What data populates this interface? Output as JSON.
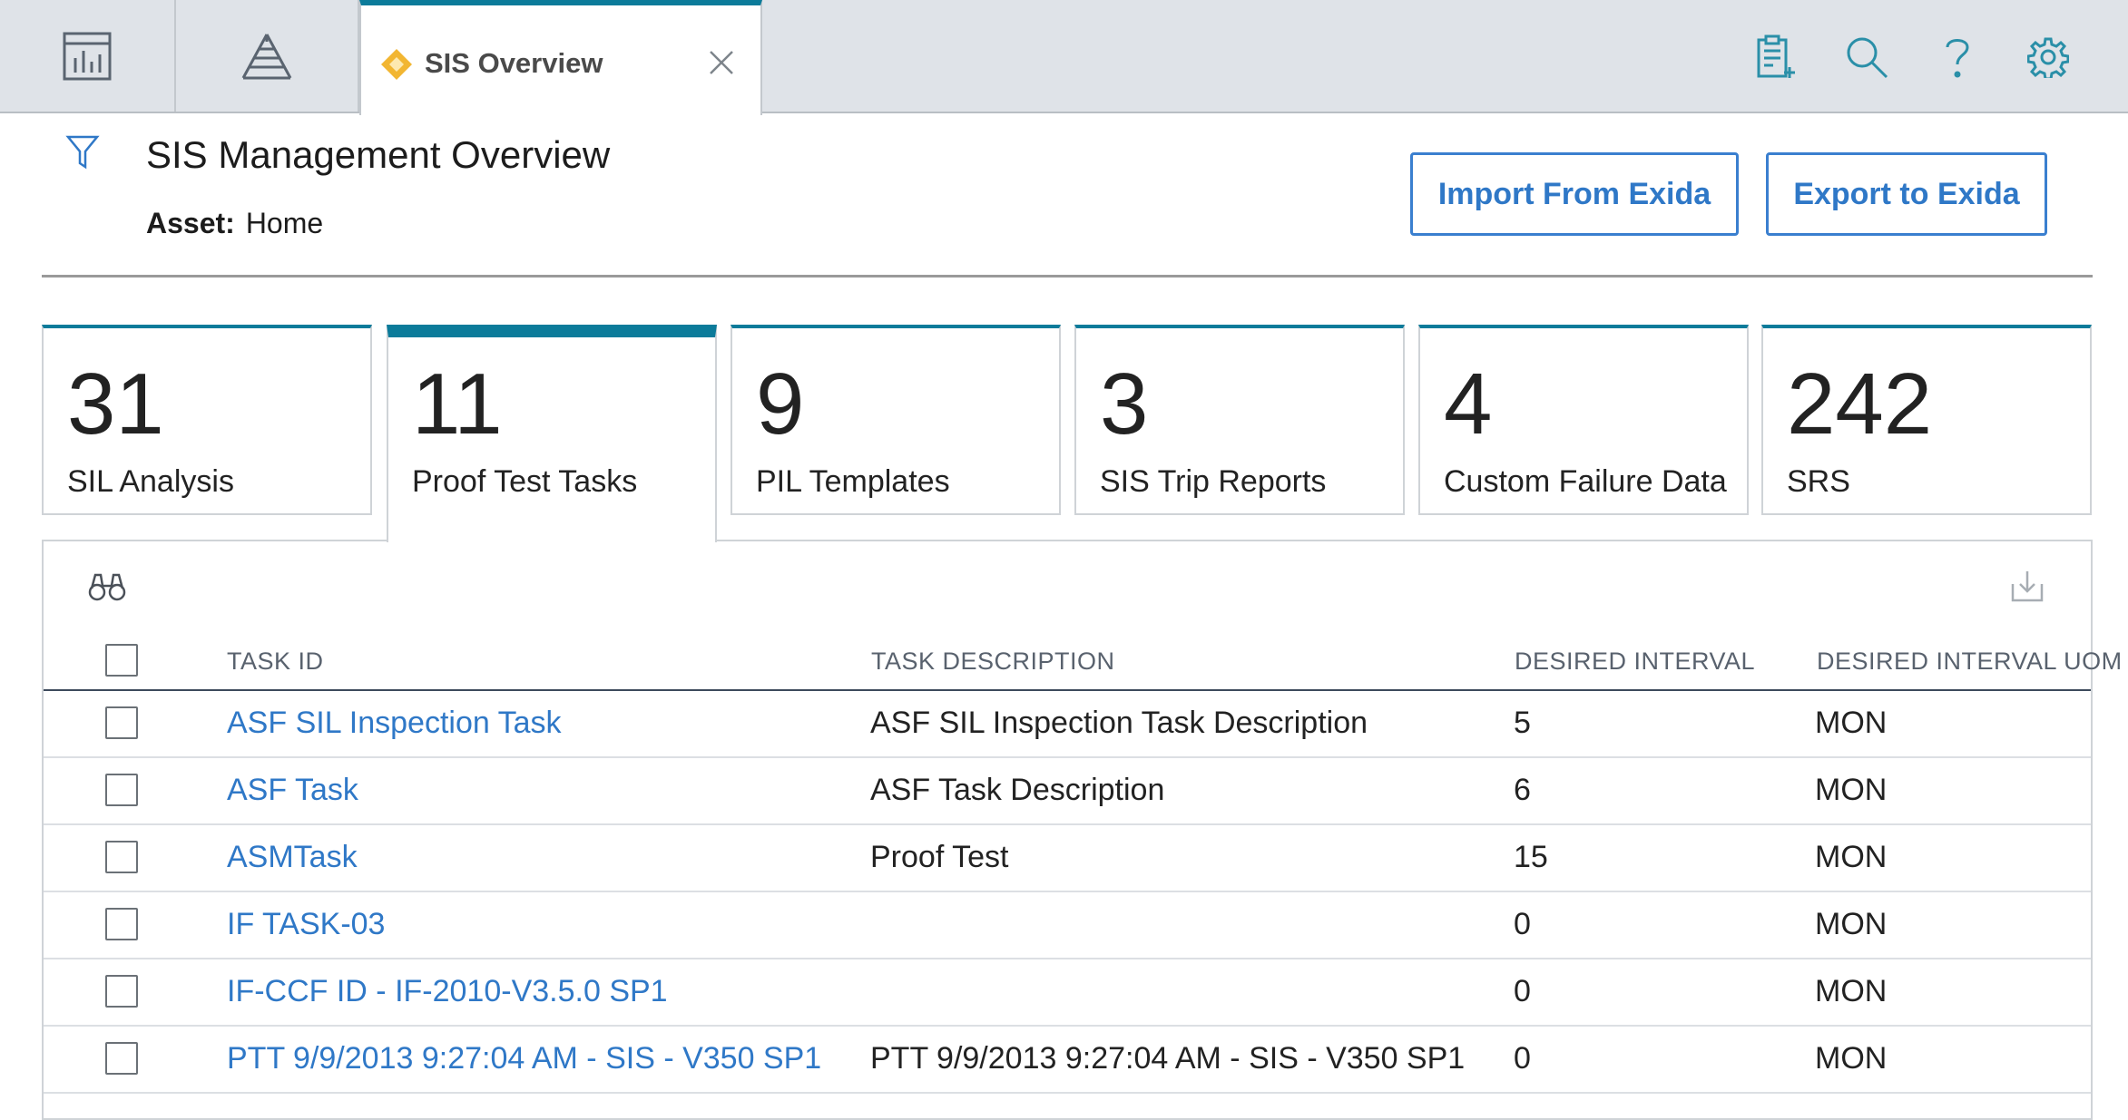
{
  "topbar": {
    "nav": [
      {
        "icon": "dashboard-icon"
      },
      {
        "icon": "hierarchy-pyramid-icon"
      }
    ],
    "active_tab": {
      "label": "SIS Overview",
      "icon": "diamond-icon"
    },
    "actions": [
      {
        "icon": "clipboard-add-icon"
      },
      {
        "icon": "search-icon"
      },
      {
        "icon": "help-icon"
      },
      {
        "icon": "gear-icon"
      }
    ]
  },
  "header": {
    "title": "SIS Management Overview",
    "asset_label": "Asset:",
    "asset_value": "Home",
    "import_button": "Import From Exida",
    "export_button": "Export to Exida"
  },
  "cards": [
    {
      "count": "31",
      "label": "SIL Analysis"
    },
    {
      "count": "11",
      "label": "Proof Test Tasks"
    },
    {
      "count": "9",
      "label": "PIL Templates"
    },
    {
      "count": "3",
      "label": "SIS Trip Reports"
    },
    {
      "count": "4",
      "label": "Custom Failure Data"
    },
    {
      "count": "242",
      "label": "SRS"
    }
  ],
  "grid": {
    "columns": [
      "TASK ID",
      "TASK DESCRIPTION",
      "DESIRED INTERVAL",
      "DESIRED INTERVAL UOM"
    ],
    "rows": [
      {
        "task_id": "ASF SIL Inspection Task",
        "description": "ASF SIL Inspection Task Description",
        "interval": "5",
        "uom": "MON"
      },
      {
        "task_id": "ASF Task",
        "description": "ASF Task Description",
        "interval": "6",
        "uom": "MON"
      },
      {
        "task_id": "ASMTask",
        "description": "Proof Test",
        "interval": "15",
        "uom": "MON"
      },
      {
        "task_id": "IF TASK-03",
        "description": "",
        "interval": "0",
        "uom": "MON"
      },
      {
        "task_id": "IF-CCF ID - IF-2010-V3.5.0 SP1",
        "description": "",
        "interval": "0",
        "uom": "MON"
      },
      {
        "task_id": "PTT 9/9/2013 9:27:04 AM - SIS - V350 SP1",
        "description": "PTT 9/9/2013 9:27:04 AM - SIS - V350 SP1",
        "interval": "0",
        "uom": "MON"
      }
    ]
  },
  "colors": {
    "accent": "#0b7b9a",
    "link": "#2f78c7",
    "button_border": "#3a7fcf",
    "tab_diamond": "#f2b632"
  }
}
